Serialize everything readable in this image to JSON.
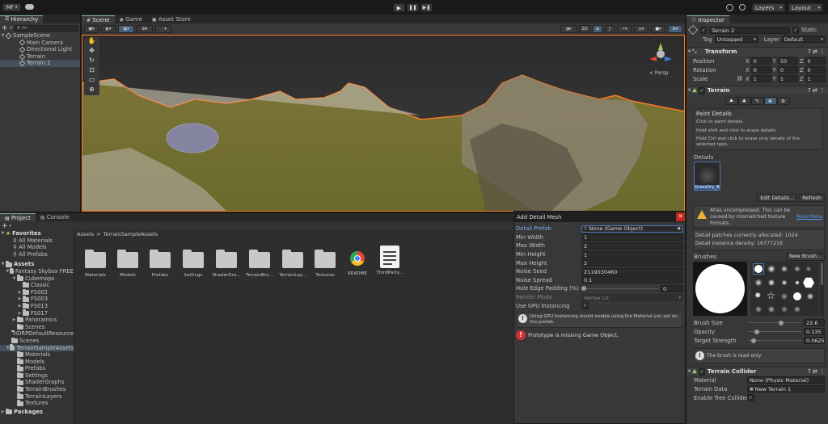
{
  "toolbar": {
    "account": "MF",
    "layers": "Layers",
    "layout": "Layout"
  },
  "hierarchy": {
    "tab": "Hierarchy",
    "search_placeholder": "All",
    "scene": "SampleScene",
    "items": [
      "Main Camera",
      "Directional Light",
      "Terrain",
      "Terrain 2"
    ]
  },
  "scene_tabs": [
    "Scene",
    "Game",
    "Asset Store"
  ],
  "scene_view": {
    "mode_2d": "2D",
    "persp": "< Persp"
  },
  "project": {
    "tabs": [
      "Project",
      "Console"
    ],
    "favorites_label": "Favorites",
    "favorites": [
      "All Materials",
      "All Models",
      "All Prefabs"
    ],
    "assets_label": "Assets",
    "tree": [
      {
        "label": "Fantasy Skybox FREE",
        "depth": 1
      },
      {
        "label": "Cubemaps",
        "depth": 2
      },
      {
        "label": "Classic",
        "depth": 3
      },
      {
        "label": "FS002",
        "depth": 3
      },
      {
        "label": "FS003",
        "depth": 3
      },
      {
        "label": "FS013",
        "depth": 3
      },
      {
        "label": "FS017",
        "depth": 3
      },
      {
        "label": "Panoramics",
        "depth": 2
      },
      {
        "label": "Scenes",
        "depth": 2
      },
      {
        "label": "HDRPDefaultResources",
        "depth": 1
      },
      {
        "label": "Scenes",
        "depth": 1
      },
      {
        "label": "TerrainSampleAssets",
        "depth": 1
      },
      {
        "label": "Materials",
        "depth": 2
      },
      {
        "label": "Models",
        "depth": 2
      },
      {
        "label": "Prefabs",
        "depth": 2
      },
      {
        "label": "Settings",
        "depth": 2
      },
      {
        "label": "ShaderGraphs",
        "depth": 2
      },
      {
        "label": "TerrainBrushes",
        "depth": 2
      },
      {
        "label": "TerrainLayers",
        "depth": 2
      },
      {
        "label": "Textures",
        "depth": 2
      }
    ],
    "packages_label": "Packages",
    "breadcrumb": [
      "Assets",
      "TerrainSampleAssets"
    ],
    "assets": [
      "Materials",
      "Models",
      "Prefabs",
      "Settings",
      "ShaderGra...",
      "TerrainBru...",
      "TerrainLay...",
      "Textures",
      "README",
      "ThirdParty..."
    ]
  },
  "dialog": {
    "title": "Add Detail Mesh",
    "rows": [
      {
        "label": "Detail Prefab",
        "value": "None (Game Object)"
      },
      {
        "label": "Min Width",
        "value": "1"
      },
      {
        "label": "Max Width",
        "value": "2"
      },
      {
        "label": "Min Height",
        "value": "1"
      },
      {
        "label": "Max Height",
        "value": "2"
      },
      {
        "label": "Noise Seed",
        "value": "2119030460"
      },
      {
        "label": "Noise Spread",
        "value": "0.1"
      },
      {
        "label": "Hole Edge Padding (%)",
        "value": "0"
      },
      {
        "label": "Render Mode",
        "value": "Vertex Lit"
      },
      {
        "label": "Use GPU Instancing",
        "value": "✓"
      }
    ],
    "info": "Using GPU Instancing would enable using the Material you set on the prefab.",
    "error": "Prototype is missing Game Object."
  },
  "inspector": {
    "tab": "Inspector",
    "object_name": "Terrain 2",
    "static_label": "Static",
    "tag_label": "Tag",
    "tag_value": "Untagged",
    "layer_label": "Layer",
    "layer_value": "Default",
    "transform": {
      "title": "Transform",
      "rows": [
        {
          "label": "Position",
          "x": "0",
          "y": "50",
          "z": "0"
        },
        {
          "label": "Rotation",
          "x": "0",
          "y": "0",
          "z": "0"
        },
        {
          "label": "Scale",
          "x": "1",
          "y": "1",
          "z": "1"
        }
      ]
    },
    "terrain": {
      "title": "Terrain",
      "paint_title": "Paint Details",
      "paint_lines": [
        "Click to paint details.",
        "Hold shift and click to erase details.",
        "Hold Ctrl and click to erase only details of the selected type."
      ],
      "details_label": "Details",
      "detail_item": "GrassDry_B",
      "edit_details": "Edit Details...",
      "refresh": "Refresh",
      "warning": "Atlas uncompressed. This can be caused by mismatched texture formats.",
      "read_more": "Read More",
      "patches": "Detail patches currently allocated: 1024",
      "density": "Detail instance density: 16777216",
      "brushes_label": "Brushes",
      "new_brush": "New Brush...",
      "brush_size_label": "Brush Size",
      "brush_size": "22.6",
      "opacity_label": "Opacity",
      "opacity": "0.135",
      "target_label": "Target Strength",
      "target": "0.0625",
      "readonly": "The brush is read-only."
    },
    "collider": {
      "title": "Terrain Collider",
      "material_label": "Material",
      "material_value": "None (Physic Material)",
      "data_label": "Terrain Data",
      "data_value": "New Terrain 1",
      "trees_label": "Enable Tree Colliders",
      "trees_value": "✓"
    }
  }
}
